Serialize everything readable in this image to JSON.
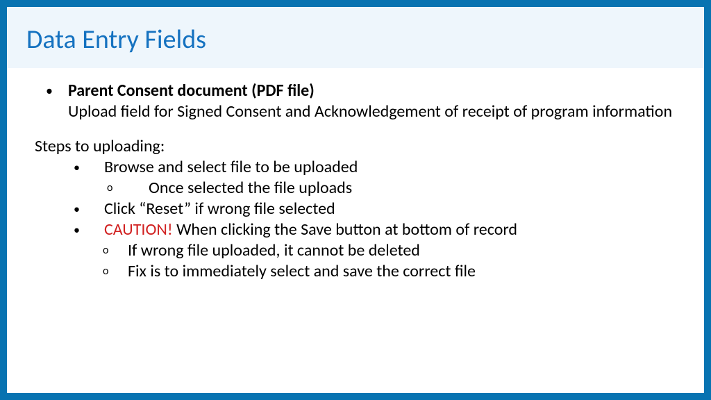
{
  "title": "Data Entry Fields",
  "mainBullet": {
    "heading": "Parent Consent document (PDF file)",
    "description": "Upload field for Signed Consent and Acknowledgement of receipt of program information"
  },
  "stepsHeader": "Steps to uploading:",
  "steps": [
    {
      "text": "Browse and select file to be uploaded",
      "sub": [
        "Once selected the file uploads"
      ]
    },
    {
      "text": "Click “Reset” if wrong file selected",
      "sub": []
    },
    {
      "caution": "CAUTION!",
      "text": " When clicking the Save button at bottom of record",
      "sub": [
        "If wrong file uploaded, it cannot be deleted",
        "Fix is to immediately select and save the correct file"
      ]
    }
  ]
}
